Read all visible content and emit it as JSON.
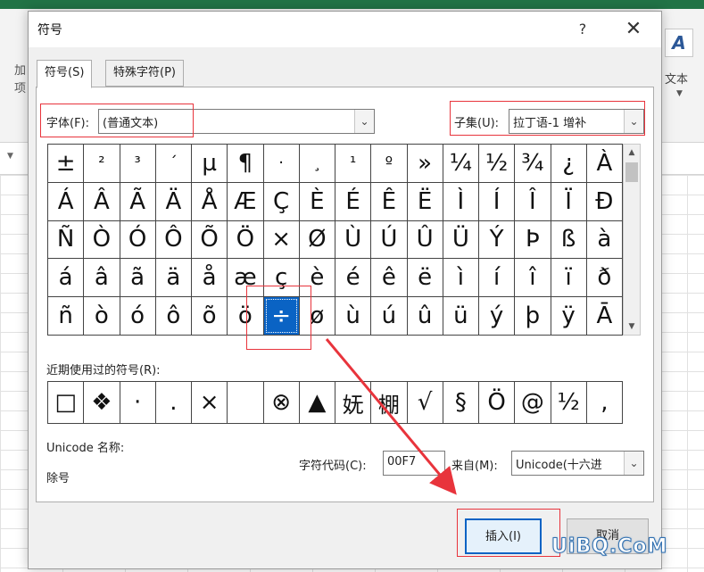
{
  "background": {
    "ribbon_left_labels": [
      "加",
      "项"
    ],
    "ribbon_right_text": "文本"
  },
  "dialog": {
    "title": "符号",
    "help_label": "?",
    "close_label": "✕",
    "tabs": [
      {
        "label": "符号(S)"
      },
      {
        "label": "特殊字符(P)"
      }
    ],
    "font": {
      "label": "字体(F):",
      "value": "(普通文本)"
    },
    "subset": {
      "label": "子集(U):",
      "value": "拉丁语-1 增补"
    },
    "symbols": [
      [
        "±",
        "²",
        "³",
        "´",
        "µ",
        "¶",
        "·",
        "¸",
        "¹",
        "º",
        "»",
        "¼",
        "½",
        "¾",
        "¿",
        "À"
      ],
      [
        "Á",
        "Â",
        "Ã",
        "Ä",
        "Å",
        "Æ",
        "Ç",
        "È",
        "É",
        "Ê",
        "Ë",
        "Ì",
        "Í",
        "Î",
        "Ï",
        "Ð"
      ],
      [
        "Ñ",
        "Ò",
        "Ó",
        "Ô",
        "Õ",
        "Ö",
        "×",
        "Ø",
        "Ù",
        "Ú",
        "Û",
        "Ü",
        "Ý",
        "Þ",
        "ß",
        "à"
      ],
      [
        "á",
        "â",
        "ã",
        "ä",
        "å",
        "æ",
        "ç",
        "è",
        "é",
        "ê",
        "ë",
        "ì",
        "í",
        "î",
        "ï",
        "ð"
      ],
      [
        "ñ",
        "ò",
        "ó",
        "ô",
        "õ",
        "ö",
        "÷",
        "ø",
        "ù",
        "ú",
        "û",
        "ü",
        "ý",
        "þ",
        "ÿ",
        "Ā"
      ]
    ],
    "selected_symbol": "÷",
    "recent_label": "近期使用过的符号(R):",
    "recent_symbols": [
      "□",
      "❖",
      "·",
      ".",
      "×",
      " ",
      "⊗",
      "▲",
      "妩",
      "棚",
      "√",
      "§",
      "Ö",
      "@",
      "½",
      ","
    ],
    "unicode_name_label": "Unicode 名称:",
    "unicode_name_value": "除号",
    "char_code_label": "字符代码(C):",
    "char_code_value": "00F7",
    "from_label": "来自(M):",
    "from_value": "Unicode(十六进",
    "insert_label": "插入(I)",
    "cancel_label": "取消"
  },
  "watermark": "UiBQ.CoM",
  "colors": {
    "excel_green": "#217346",
    "annotation_red": "#e8343c",
    "selection_blue": "#0a63c4"
  }
}
